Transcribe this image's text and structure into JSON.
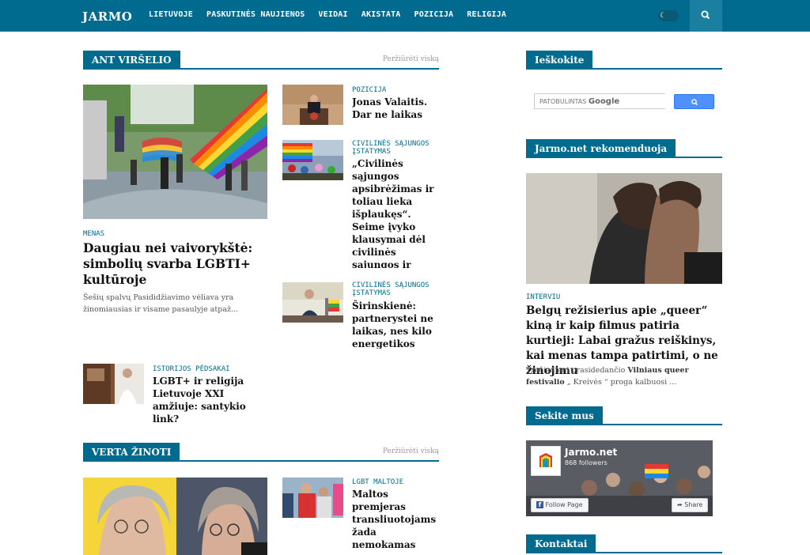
{
  "nav": {
    "logo": "JARMO",
    "items": [
      "LIETUVOJE",
      "PASKUTINĖS NAUJIENOS",
      "VEIDAI",
      "AKISTATA",
      "POZICIJA",
      "RELIGIJA"
    ]
  },
  "ant_virselio": {
    "label": "ANT VIRŠELIO",
    "more": "Peržiūrėti viską",
    "lead": {
      "category": "MENAS",
      "title": "Daugiau nei vaivorykštė: simbolių svarba LGBTI+ kultūroje",
      "excerpt": "Šešių spalvų Pasididžiavimo vėliava yra žinomiausias ir visame pasaulyje atpaž..."
    },
    "items": [
      {
        "category": "POZICIJA",
        "title": "Jonas Valaitis. Dar ne laikas"
      },
      {
        "category": "CIVILINĖS SĄJUNGOS ĮSTATYMAS",
        "title": "„Civilinės sąjungos apsibrėžimas ir toliau lieka išplaukęs“. Seime įvyko klausymai dėl civilinės sąjungos ir „artimo ryšio“"
      },
      {
        "category": "CIVILINĖS SĄJUNGOS ĮSTATYMAS",
        "title": "Širinskienė: partnerystei ne laikas, nes kilo energetikos krizė"
      },
      {
        "category": "ISTORIJOS PĖDSAKAI",
        "title": "LGBT+ ir religija Lietuvoje XXI amžiuje: santykio link?"
      }
    ]
  },
  "verta_zinoti": {
    "label": "VERTA ŽINOTI",
    "more": "Peržiūrėti viską",
    "items": [
      {
        "category": "LGBT MALTOJE",
        "title": "Maltos premjeras transliuotojams žada nemokamas lyties keitimo operacijas"
      }
    ]
  },
  "sidebar": {
    "search_label": "Ieškokite",
    "search_placeholder": "PATOBULINTAS",
    "search_brand": "Google",
    "recommend_label": "Jarmo.net rekomenduoja",
    "rec_category": "INTERVIU",
    "rec_title": "Belgų režisierius apie „queer“ kiną ir kaip filmus patiria kurtieji: Labai gražus reiškinys, kai menas tampa patirtimi, o ne žinojimu",
    "rec_excerpt_pre": "Trečiadienį prasidedančio ",
    "rec_excerpt_bold": "Vilniaus queer festivalio",
    "rec_excerpt_post": " „ Kreivės “ proga kalbuosi ...",
    "follow_label": "Sekite mus",
    "fb_name": "Jarmo.net",
    "fb_followers": "868 followers",
    "fb_follow_btn": "Follow Page",
    "fb_share_btn": "Share",
    "contacts_label": "Kontaktai"
  },
  "colors": {
    "brand": "#006b8f",
    "category": "#006b8f"
  }
}
